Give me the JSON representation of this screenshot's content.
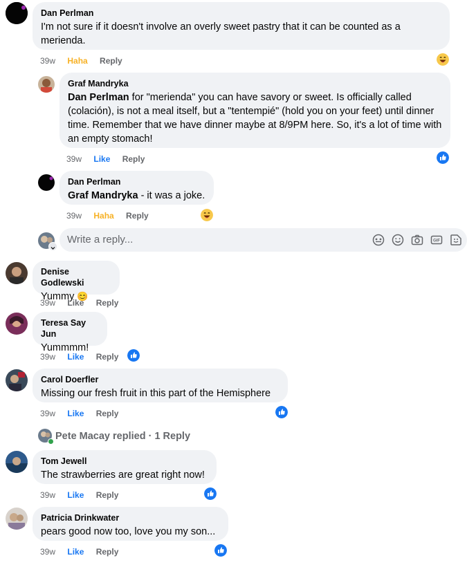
{
  "comments": [
    {
      "author": "Dan Perlman",
      "text": "I'm not sure if it doesn't involve an overly sweet pastry that it can be counted as a merienda.",
      "time": "39w",
      "reaction": "Haha",
      "reply": "Reply"
    },
    {
      "author": "Graf Mandryka",
      "mention": "Dan Perlman",
      "text": " for \"merienda\" you can have savory or sweet. Is officially called (colación), is not a meal itself, but a \"tentempié\" (hold you on your feet) until dinner time. Remember that we have dinner maybe at 8/9PM here. So, it's a lot of time with an empty stomach!",
      "time": "39w",
      "reaction": "Like",
      "reply": "Reply"
    },
    {
      "author": "Dan Perlman",
      "mention": "Graf Mandryka",
      "text": " - it was a joke.",
      "time": "39w",
      "reaction": "Haha",
      "reply": "Reply"
    },
    {
      "author": "Denise Godlewski",
      "text": "Yummy",
      "emoji": "😊",
      "time": "39w",
      "reaction": "Like",
      "reply": "Reply"
    },
    {
      "author": "Teresa Say Jun",
      "text": "Yummmm!",
      "time": "39w",
      "reaction": "Like",
      "reply": "Reply"
    },
    {
      "author": "Carol Doerfler",
      "text": "Missing our fresh fruit in this part of the Hemisphere",
      "time": "39w",
      "reaction": "Like",
      "reply": "Reply"
    },
    {
      "author": "Tom Jewell",
      "text": "The strawberries are great right now!",
      "time": "39w",
      "reaction": "Like",
      "reply": "Reply"
    },
    {
      "author": "Patricia Drinkwater",
      "text": "pears good now too, love you my son...",
      "time": "39w",
      "reaction": "Like",
      "reply": "Reply"
    }
  ],
  "reply_box": {
    "placeholder": "Write a reply..."
  },
  "replies_summary": {
    "text": "Pete Macay replied · 1 Reply"
  },
  "colors": {
    "bubble": "#f0f2f5",
    "like": "#1877f2",
    "haha": "#f7b125",
    "muted": "#65676b"
  },
  "icons": [
    "like-reaction-icon",
    "haha-reaction-icon",
    "avatar-sticker-icon",
    "emoji-icon",
    "camera-icon",
    "gif-icon",
    "sticker-icon"
  ]
}
